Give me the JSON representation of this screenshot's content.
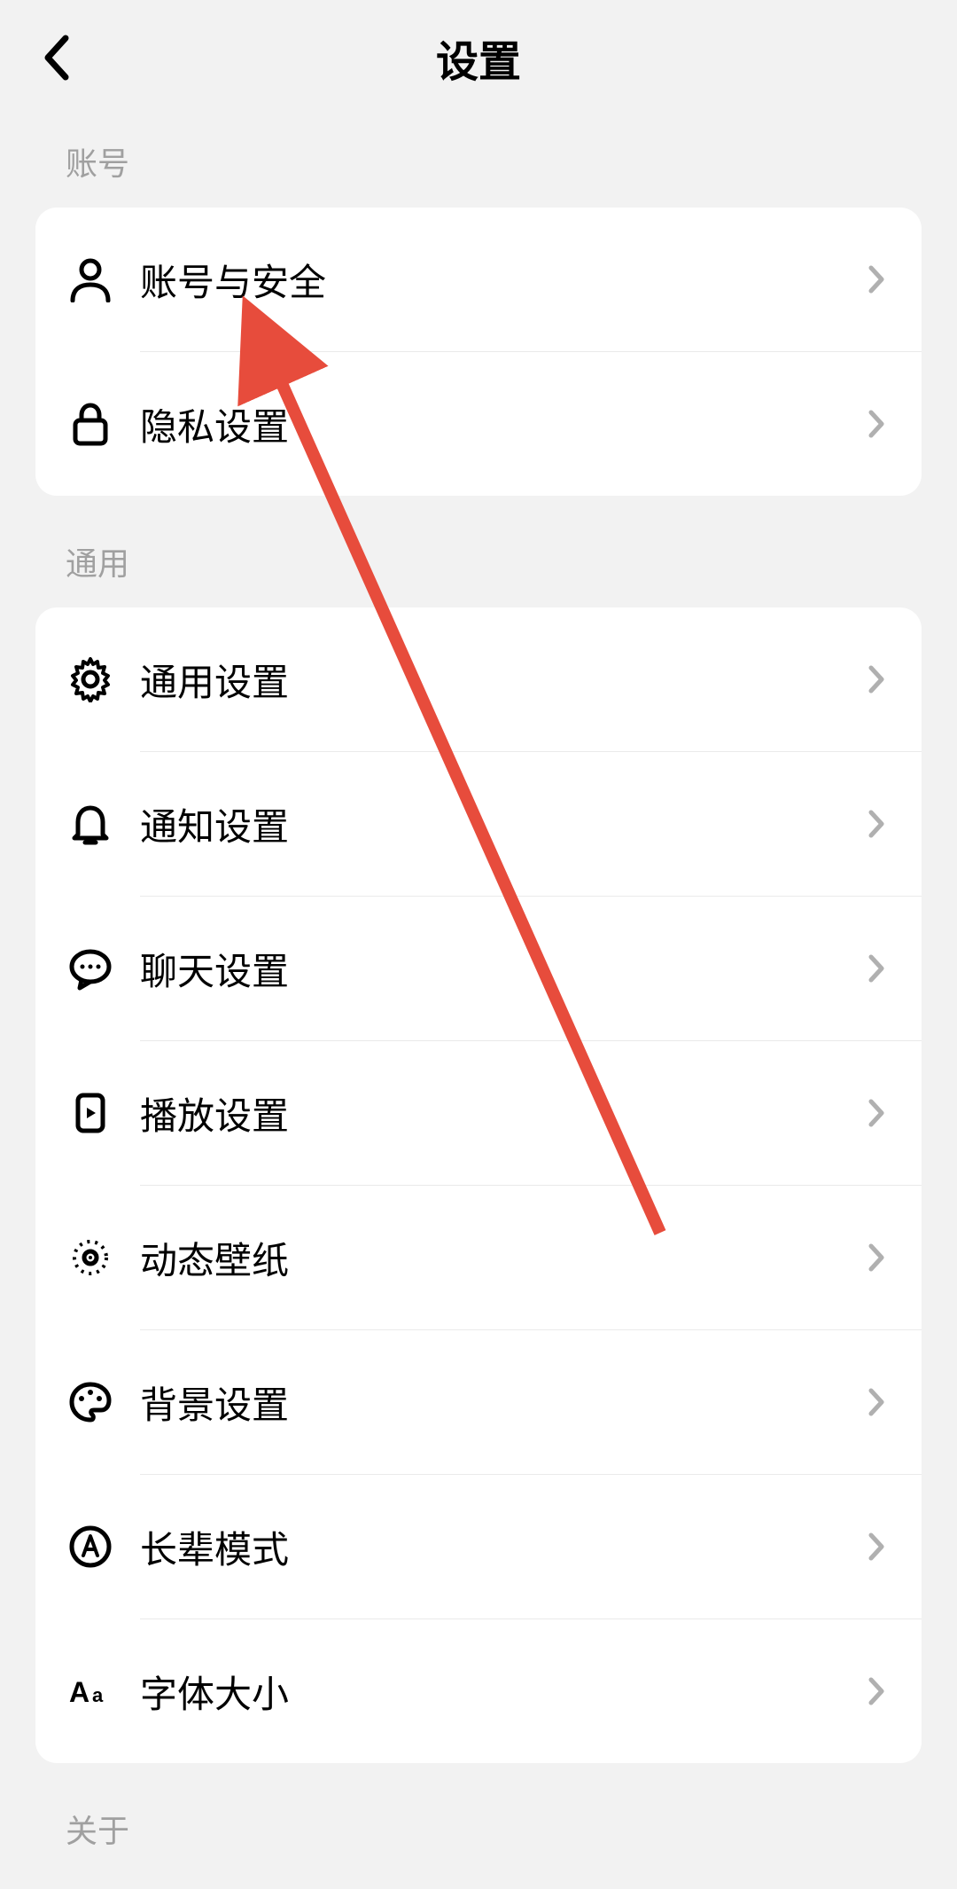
{
  "header": {
    "title": "设置"
  },
  "sections": [
    {
      "label": "账号",
      "items": [
        {
          "icon": "user",
          "label": "账号与安全",
          "name": "row-account-security"
        },
        {
          "icon": "lock",
          "label": "隐私设置",
          "name": "row-privacy"
        }
      ]
    },
    {
      "label": "通用",
      "items": [
        {
          "icon": "gear",
          "label": "通用设置",
          "name": "row-general"
        },
        {
          "icon": "bell",
          "label": "通知设置",
          "name": "row-notification"
        },
        {
          "icon": "chat",
          "label": "聊天设置",
          "name": "row-chat"
        },
        {
          "icon": "play",
          "label": "播放设置",
          "name": "row-playback"
        },
        {
          "icon": "wallpaper",
          "label": "动态壁纸",
          "name": "row-live-wallpaper"
        },
        {
          "icon": "palette",
          "label": "背景设置",
          "name": "row-background"
        },
        {
          "icon": "a-circle",
          "label": "长辈模式",
          "name": "row-elder-mode"
        },
        {
          "icon": "aa",
          "label": "字体大小",
          "name": "row-font-size"
        }
      ]
    },
    {
      "label": "关于",
      "items": []
    }
  ]
}
